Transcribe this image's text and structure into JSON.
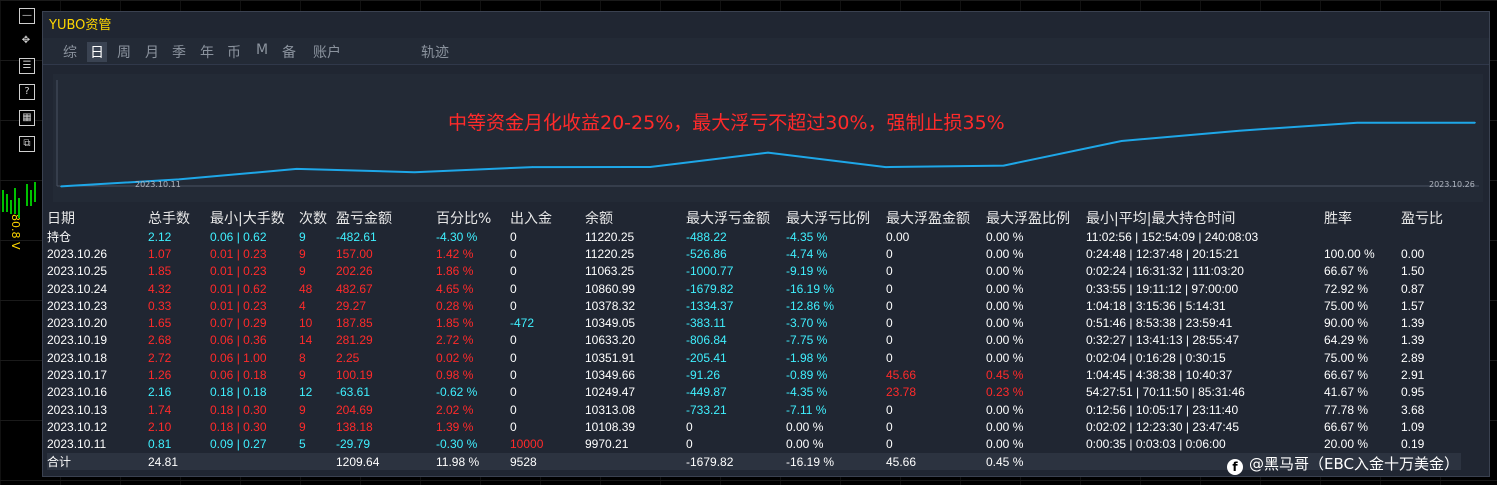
{
  "window": {
    "title": "YUBO资管"
  },
  "tabs": [
    {
      "label": "综",
      "active": false
    },
    {
      "label": "日",
      "active": true
    },
    {
      "label": "周",
      "active": false
    },
    {
      "label": "月",
      "active": false
    },
    {
      "label": "季",
      "active": false
    },
    {
      "label": "年",
      "active": false
    },
    {
      "label": "币",
      "active": false
    },
    {
      "label": "M",
      "active": false
    },
    {
      "label": "备",
      "active": false
    },
    {
      "label": "账户",
      "active": false
    },
    {
      "label": "轨迹",
      "active": false
    }
  ],
  "left_toolbar": {
    "buttons": [
      "—",
      "✥",
      "☰",
      "?",
      "▦",
      "⧉"
    ],
    "price_label": "80.8 V"
  },
  "chart": {
    "headline": "中等资金月化收益20-25%，最大浮亏不超过30%，强制止损35%",
    "date_start": "2023.10.11",
    "date_end": "2023.10.26",
    "line_color": "#1ea7e8"
  },
  "chart_data": {
    "type": "line",
    "title": "中等资金月化收益20-25%，最大浮亏不超过30%，强制止损35%",
    "x": [
      "2023.10.11",
      "2023.10.12",
      "2023.10.13",
      "2023.10.16",
      "2023.10.17",
      "2023.10.18",
      "2023.10.19",
      "2023.10.20",
      "2023.10.23",
      "2023.10.24",
      "2023.10.25",
      "2023.10.26",
      "now"
    ],
    "values": [
      9970.21,
      10108.39,
      10313.08,
      10249.47,
      10349.66,
      10351.91,
      10633.2,
      10349.05,
      10378.32,
      10860.99,
      11063.25,
      11220.25,
      11220.25
    ]
  },
  "table": {
    "headers": [
      "日期",
      "总手数",
      "最小|大手数",
      "次数",
      "盈亏金额",
      "百分比%",
      "出入金",
      "余额",
      "最大浮亏金额",
      "最大浮亏比例",
      "最大浮盈金额",
      "最大浮盈比例",
      "最小|平均|最大持仓时间",
      "胜率",
      "盈亏比"
    ],
    "rows": [
      {
        "date": "持仓",
        "lots": "2.12",
        "minmax": "0.06 | 0.62",
        "count": "9",
        "pnl": "-482.61",
        "pct": "-4.30 %",
        "io": "0",
        "bal": "11220.25",
        "mfl": "-488.22",
        "mflp": "-4.35 %",
        "mfp": "0.00",
        "mfpp": "0.00 %",
        "hold": "11:02:56 | 152:54:09 | 240:08:03",
        "win": "",
        "pf": "",
        "pos": false
      },
      {
        "date": "2023.10.26",
        "lots": "1.07",
        "minmax": "0.01 | 0.23",
        "count": "9",
        "pnl": "157.00",
        "pct": "1.42 %",
        "io": "0",
        "bal": "11220.25",
        "mfl": "-526.86",
        "mflp": "-4.74 %",
        "mfp": "0",
        "mfpp": "0.00 %",
        "hold": "0:24:48 | 12:37:48 | 20:15:21",
        "win": "100.00 %",
        "pf": "0.00",
        "pos": true
      },
      {
        "date": "2023.10.25",
        "lots": "1.85",
        "minmax": "0.01 | 0.23",
        "count": "9",
        "pnl": "202.26",
        "pct": "1.86 %",
        "io": "0",
        "bal": "11063.25",
        "mfl": "-1000.77",
        "mflp": "-9.19 %",
        "mfp": "0",
        "mfpp": "0.00 %",
        "hold": "0:02:24 | 16:31:32 | 111:03:20",
        "win": "66.67 %",
        "pf": "1.50",
        "pos": true
      },
      {
        "date": "2023.10.24",
        "lots": "4.32",
        "minmax": "0.01 | 0.62",
        "count": "48",
        "pnl": "482.67",
        "pct": "4.65 %",
        "io": "0",
        "bal": "10860.99",
        "mfl": "-1679.82",
        "mflp": "-16.19 %",
        "mfp": "0",
        "mfpp": "0.00 %",
        "hold": "0:33:55 | 19:11:12 | 97:00:00",
        "win": "72.92 %",
        "pf": "0.87",
        "pos": true
      },
      {
        "date": "2023.10.23",
        "lots": "0.33",
        "minmax": "0.01 | 0.23",
        "count": "4",
        "pnl": "29.27",
        "pct": "0.28 %",
        "io": "0",
        "bal": "10378.32",
        "mfl": "-1334.37",
        "mflp": "-12.86 %",
        "mfp": "0",
        "mfpp": "0.00 %",
        "hold": "1:04:18 | 3:15:36 | 5:14:31",
        "win": "75.00 %",
        "pf": "1.57",
        "pos": true
      },
      {
        "date": "2023.10.20",
        "lots": "1.65",
        "minmax": "0.07 | 0.29",
        "count": "10",
        "pnl": "187.85",
        "pct": "1.85 %",
        "io": "-472",
        "bal": "10349.05",
        "mfl": "-383.11",
        "mflp": "-3.70 %",
        "mfp": "0",
        "mfpp": "0.00 %",
        "hold": "0:51:46 | 8:53:38 | 23:59:41",
        "win": "90.00 %",
        "pf": "1.39",
        "pos": true
      },
      {
        "date": "2023.10.19",
        "lots": "2.68",
        "minmax": "0.06 | 0.36",
        "count": "14",
        "pnl": "281.29",
        "pct": "2.72 %",
        "io": "0",
        "bal": "10633.20",
        "mfl": "-806.84",
        "mflp": "-7.75 %",
        "mfp": "0",
        "mfpp": "0.00 %",
        "hold": "0:32:27 | 13:41:13 | 28:55:47",
        "win": "64.29 %",
        "pf": "1.39",
        "pos": true
      },
      {
        "date": "2023.10.18",
        "lots": "2.72",
        "minmax": "0.06 | 1.00",
        "count": "8",
        "pnl": "2.25",
        "pct": "0.02 %",
        "io": "0",
        "bal": "10351.91",
        "mfl": "-205.41",
        "mflp": "-1.98 %",
        "mfp": "0",
        "mfpp": "0.00 %",
        "hold": "0:02:04 | 0:16:28 | 0:30:15",
        "win": "75.00 %",
        "pf": "2.89",
        "pos": true
      },
      {
        "date": "2023.10.17",
        "lots": "1.26",
        "minmax": "0.06 | 0.18",
        "count": "9",
        "pnl": "100.19",
        "pct": "0.98 %",
        "io": "0",
        "bal": "10349.66",
        "mfl": "-91.26",
        "mflp": "-0.89 %",
        "mfp": "45.66",
        "mfpp": "0.45 %",
        "hold": "1:04:45 | 4:38:38 | 10:40:37",
        "win": "66.67 %",
        "pf": "2.91",
        "pos": true
      },
      {
        "date": "2023.10.16",
        "lots": "2.16",
        "minmax": "0.18 | 0.18",
        "count": "12",
        "pnl": "-63.61",
        "pct": "-0.62 %",
        "io": "0",
        "bal": "10249.47",
        "mfl": "-449.87",
        "mflp": "-4.35 %",
        "mfp": "23.78",
        "mfpp": "0.23 %",
        "hold": "54:27:51 | 70:11:50 | 85:31:46",
        "win": "41.67 %",
        "pf": "0.95",
        "pos": false
      },
      {
        "date": "2023.10.13",
        "lots": "1.74",
        "minmax": "0.18 | 0.30",
        "count": "9",
        "pnl": "204.69",
        "pct": "2.02 %",
        "io": "0",
        "bal": "10313.08",
        "mfl": "-733.21",
        "mflp": "-7.11 %",
        "mfp": "0",
        "mfpp": "0.00 %",
        "hold": "0:12:56 | 10:05:17 | 23:11:40",
        "win": "77.78 %",
        "pf": "3.68",
        "pos": true
      },
      {
        "date": "2023.10.12",
        "lots": "2.10",
        "minmax": "0.18 | 0.30",
        "count": "9",
        "pnl": "138.18",
        "pct": "1.39 %",
        "io": "0",
        "bal": "10108.39",
        "mfl": "0",
        "mflp": "0.00 %",
        "mfp": "0",
        "mfpp": "0.00 %",
        "hold": "0:02:02 | 12:23:30 | 23:47:45",
        "win": "66.67 %",
        "pf": "1.09",
        "pos": true
      },
      {
        "date": "2023.10.11",
        "lots": "0.81",
        "minmax": "0.09 | 0.27",
        "count": "5",
        "pnl": "-29.79",
        "pct": "-0.30 %",
        "io": "10000",
        "bal": "9970.21",
        "mfl": "0",
        "mflp": "0.00 %",
        "mfp": "0",
        "mfpp": "0.00 %",
        "hold": "0:00:35 | 0:03:03 | 0:06:00",
        "win": "20.00 %",
        "pf": "0.19",
        "pos": false
      }
    ],
    "total": {
      "date": "合计",
      "lots": "24.81",
      "minmax": "",
      "count": "",
      "pnl": "1209.64",
      "pct": "11.98 %",
      "io": "9528",
      "bal": "",
      "mfl": "-1679.82",
      "mflp": "-16.19 %",
      "mfp": "45.66",
      "mfpp": "0.45 %",
      "hold": "",
      "win": "",
      "pf": ""
    }
  },
  "watermark": {
    "icon": "facebook-icon",
    "text": "@黑马哥（EBC入金十万美金）"
  },
  "colors": {
    "title": "#ffd700",
    "positive": "#ff2a2a",
    "negative": "#3ff0ff",
    "neutral": "#ffffff",
    "headline": "#ff2a2a"
  }
}
